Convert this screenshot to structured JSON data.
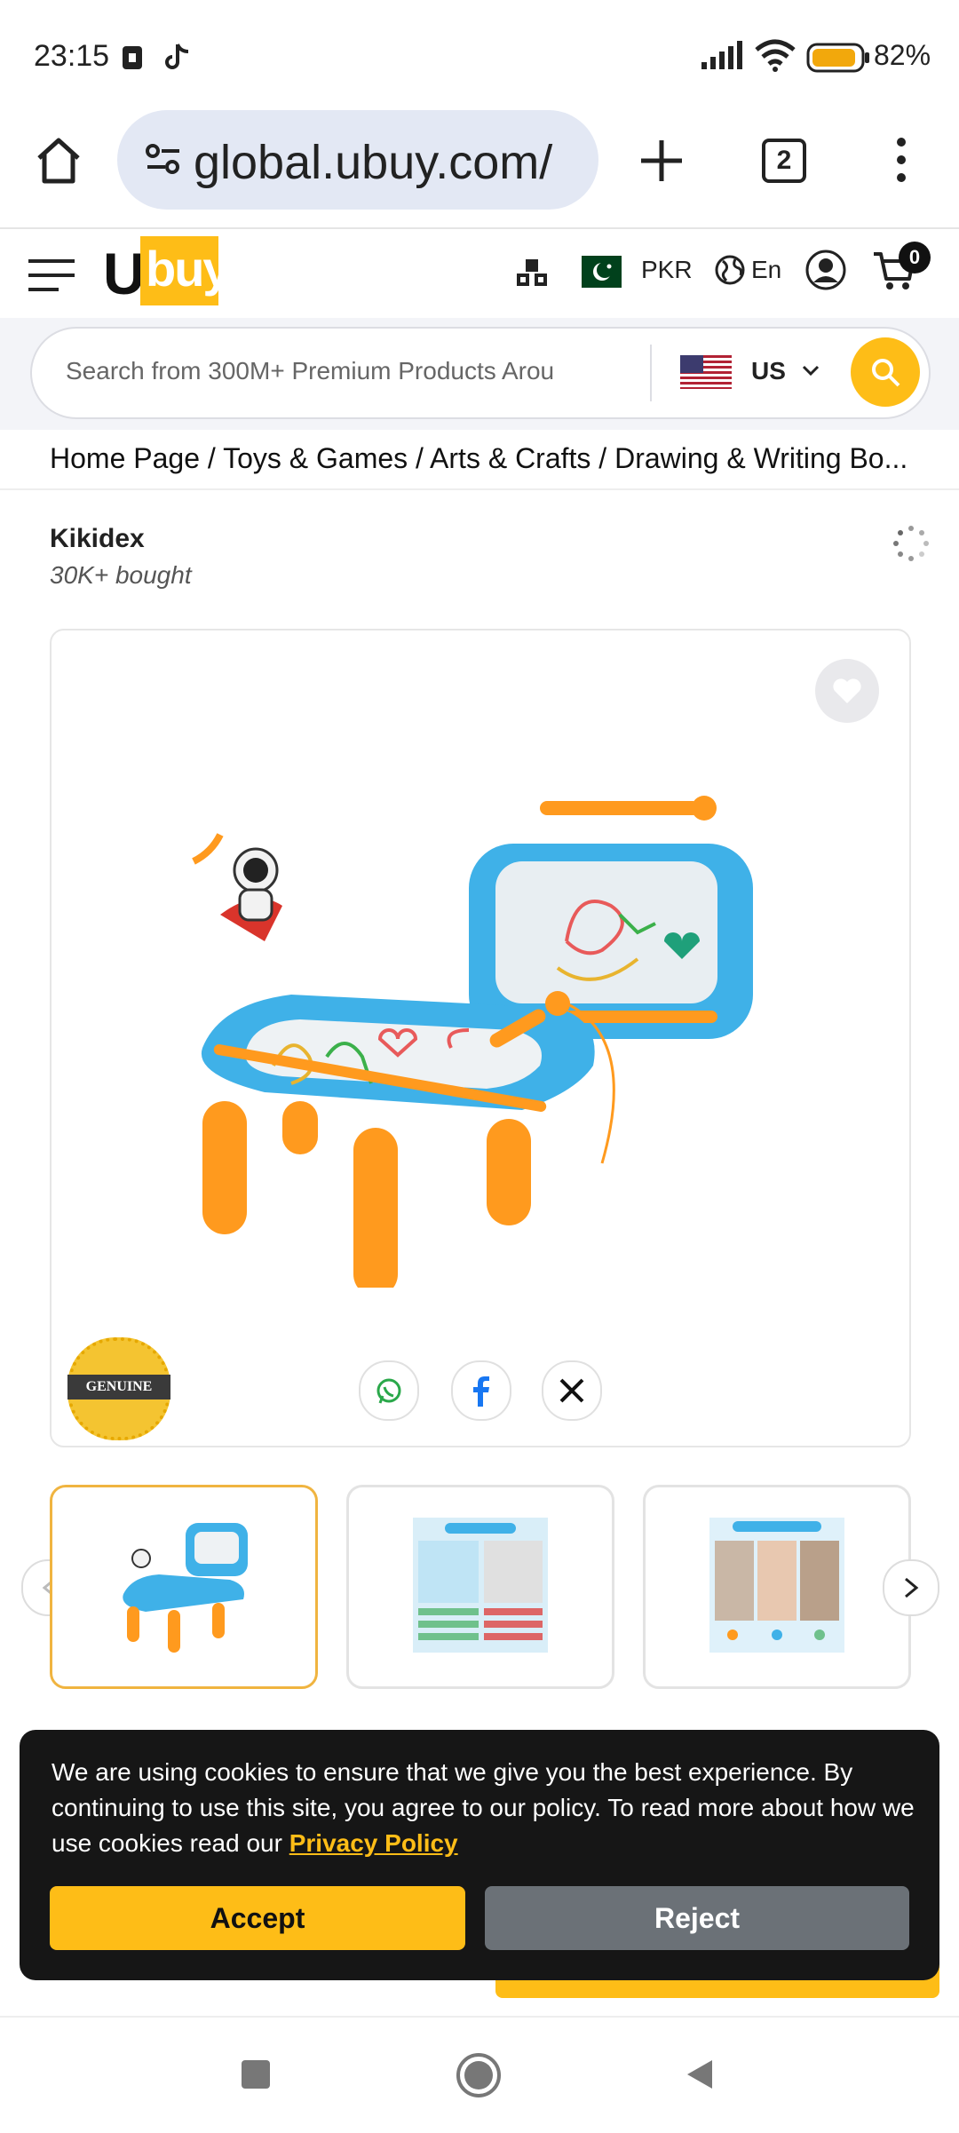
{
  "status_bar": {
    "time": "23:15",
    "battery": "82%"
  },
  "browser": {
    "url": "global.ubuy.com/",
    "tab_count": "2"
  },
  "header": {
    "logo_u": "U",
    "logo_rest": "buy",
    "currency": "PKR",
    "language": "En",
    "cart_count": "0"
  },
  "search": {
    "placeholder": "Search from 300M+ Premium Products Arou",
    "country": "US"
  },
  "breadcrumb": "Home Page / Toys & Games / Arts & Crafts / Drawing & Writing Bo...",
  "product": {
    "brand": "Kikidex",
    "bought": "30K+ bought",
    "badge": "GENUINE"
  },
  "cookie": {
    "message": "We are using cookies to ensure that we give you the best experience. By continuing to use this site, you agree to our policy. To read more about how we use cookies read our",
    "link": "Privacy Policy",
    "accept": "Accept",
    "reject": "Reject"
  },
  "colors": {
    "brand_yellow": "#febd17",
    "toy_blue": "#3fb1e8",
    "toy_orange": "#ff9a1e"
  }
}
